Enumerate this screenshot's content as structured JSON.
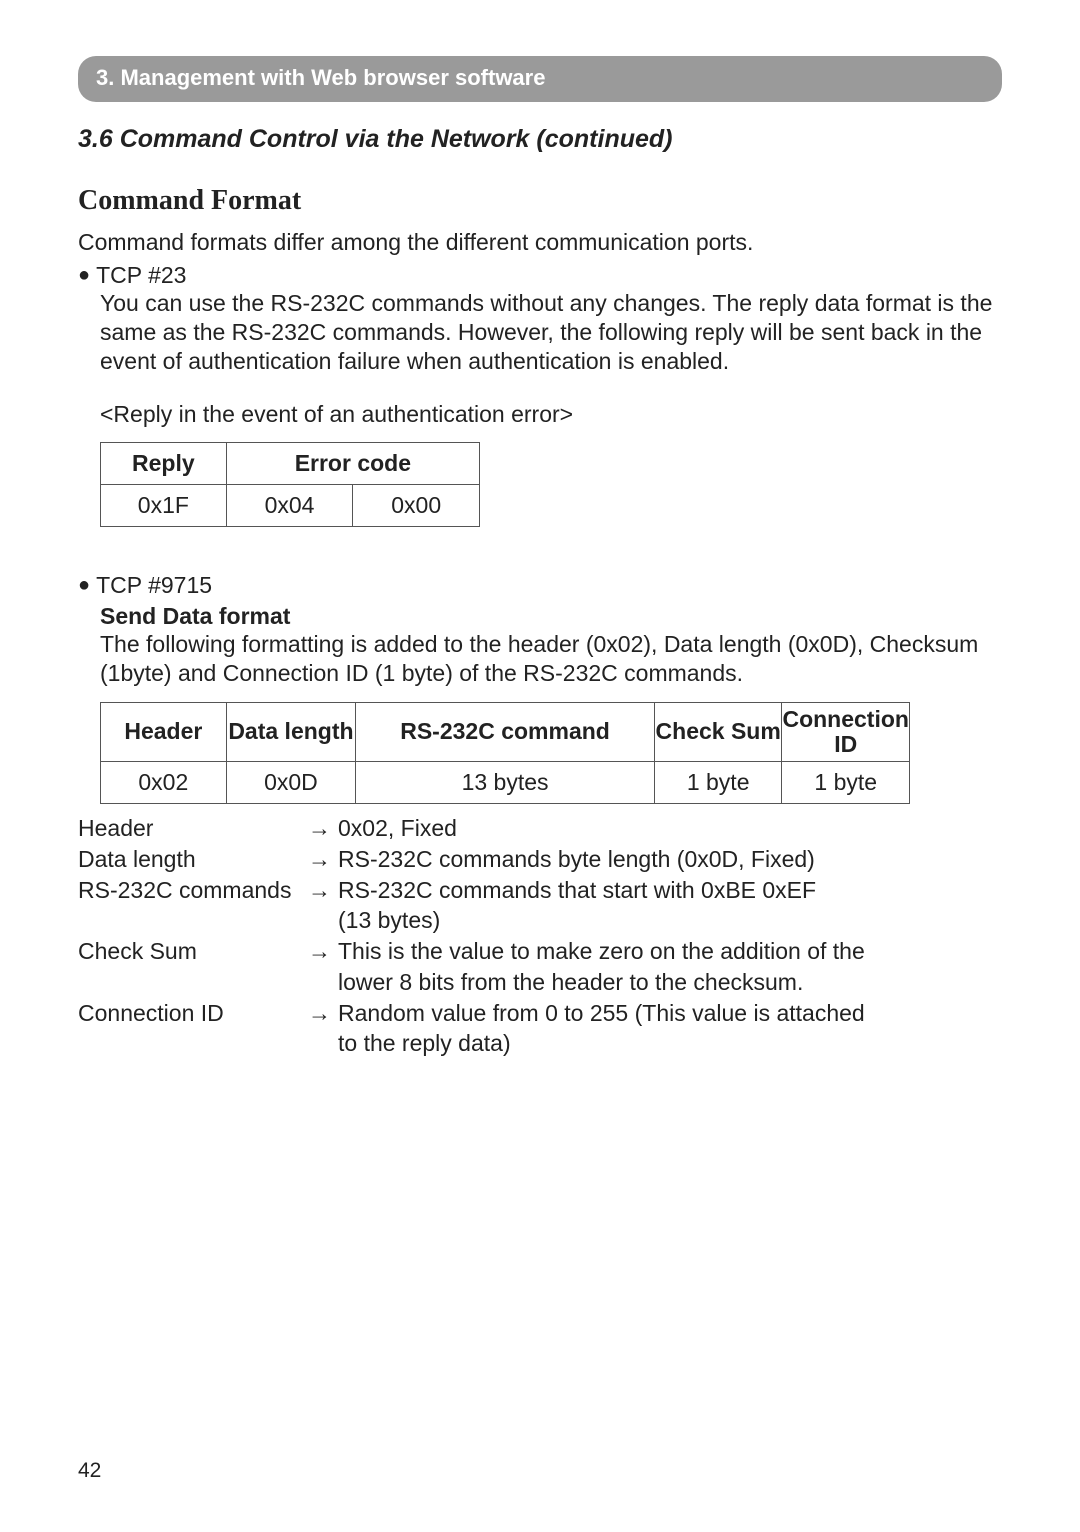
{
  "banner": "3. Management with Web browser software",
  "subsection": "3.6 Command Control via the Network (continued)",
  "heading": "Command Format",
  "intro": "Command formats differ among the different communication ports.",
  "tcp23": {
    "label": "TCP #23",
    "text": "You can use the RS-232C commands without any changes. The reply data format is the same as the RS-232C commands. However, the following reply will be sent back in the event of authentication failure when authentication is enabled.",
    "replyTitle": "<Reply in the event of an authentication error>",
    "table": {
      "h1": "Reply",
      "h2": "Error code",
      "c1": "0x1F",
      "c2": "0x04",
      "c3": "0x00"
    }
  },
  "tcp9715": {
    "label": "TCP #9715",
    "subhead": "Send Data format",
    "text": "The following formatting is added to the header (0x02), Data length (0x0D), Checksum (1byte) and Connection ID (1 byte) of the RS-232C commands.",
    "table": {
      "h1": "Header",
      "h2": "Data length",
      "h3": "RS-232C command",
      "h4": "Check Sum",
      "h5": "Connection ID",
      "c1": "0x02",
      "c2": "0x0D",
      "c3": "13 bytes",
      "c4": "1 byte",
      "c5": "1 byte"
    },
    "defs": {
      "arrow": "→",
      "r1k": "Header",
      "r1v": "0x02, Fixed",
      "r2k": "Data length",
      "r2v": "RS-232C commands byte length (0x0D, Fixed)",
      "r3k": "RS-232C commands",
      "r3v": "RS-232C commands that start with 0xBE 0xEF",
      "r3c": "(13 bytes)",
      "r4k": "Check Sum",
      "r4v": "This is the value to make zero on the addition of the",
      "r4c": "lower 8 bits from the header to the checksum.",
      "r5k": "Connection ID",
      "r5v": "Random value from 0 to 255 (This value is attached",
      "r5c": "to the reply data)"
    }
  },
  "pageNumber": "42"
}
